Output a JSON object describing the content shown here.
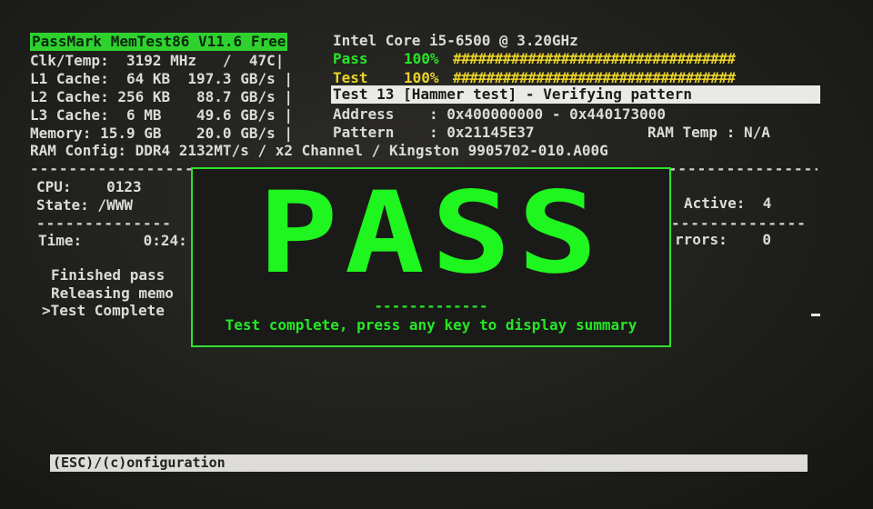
{
  "header": {
    "app_title": "PassMark MemTest86 V11.6 Free",
    "cpu_name": "Intel Core i5-6500 @ 3.20GHz",
    "clk_temp": "Clk/Temp:  3192 MHz   /  47C|",
    "l1": "L1 Cache:  64 KB  197.3 GB/s |",
    "l2": "L2 Cache: 256 KB   88.7 GB/s |",
    "l3": "L3 Cache:  6 MB    49.6 GB/s |",
    "memory": "Memory: 15.9 GB    20.0 GB/s |",
    "ram_config": "RAM Config: DDR4 2132MT/s / x2 Channel / Kingston 9905702-010.A00G"
  },
  "progress": {
    "pass_label": "Pass",
    "pass_pct": "100%",
    "test_label": "Test",
    "test_pct": "100%",
    "bar": "##################################",
    "pass_fraction": 1.0,
    "test_fraction": 1.0
  },
  "test_info": {
    "current_test": "Test 13 [Hammer test] - Verifying pattern",
    "address": "Address    : 0x400000000 - 0x440173000",
    "pattern": "Pattern    : 0x21145E37",
    "ram_temp": "RAM Temp : N/A"
  },
  "left_panel": {
    "cpu": "CPU:    0123",
    "state": "State: /WWW",
    "time": "Time:       0:24:",
    "log": [
      "Finished pass",
      "Releasing memo",
      ">Test Complete"
    ]
  },
  "right_panel": {
    "active": "Active:  4",
    "errors": "rrors:    0"
  },
  "dashes": {
    "top_row": "-------------------------------------------------------------------------------------------",
    "short": "--------------",
    "pass_sep": "-------------"
  },
  "result": {
    "status": "PASS",
    "message": "Test complete, press any key to display summary"
  },
  "footer": {
    "keys": "(ESC)/(c)onfiguration"
  },
  "colors": {
    "accent_green": "#1ff51f",
    "title_green": "#2fd12f",
    "progress_yellow": "#e8d22a"
  }
}
